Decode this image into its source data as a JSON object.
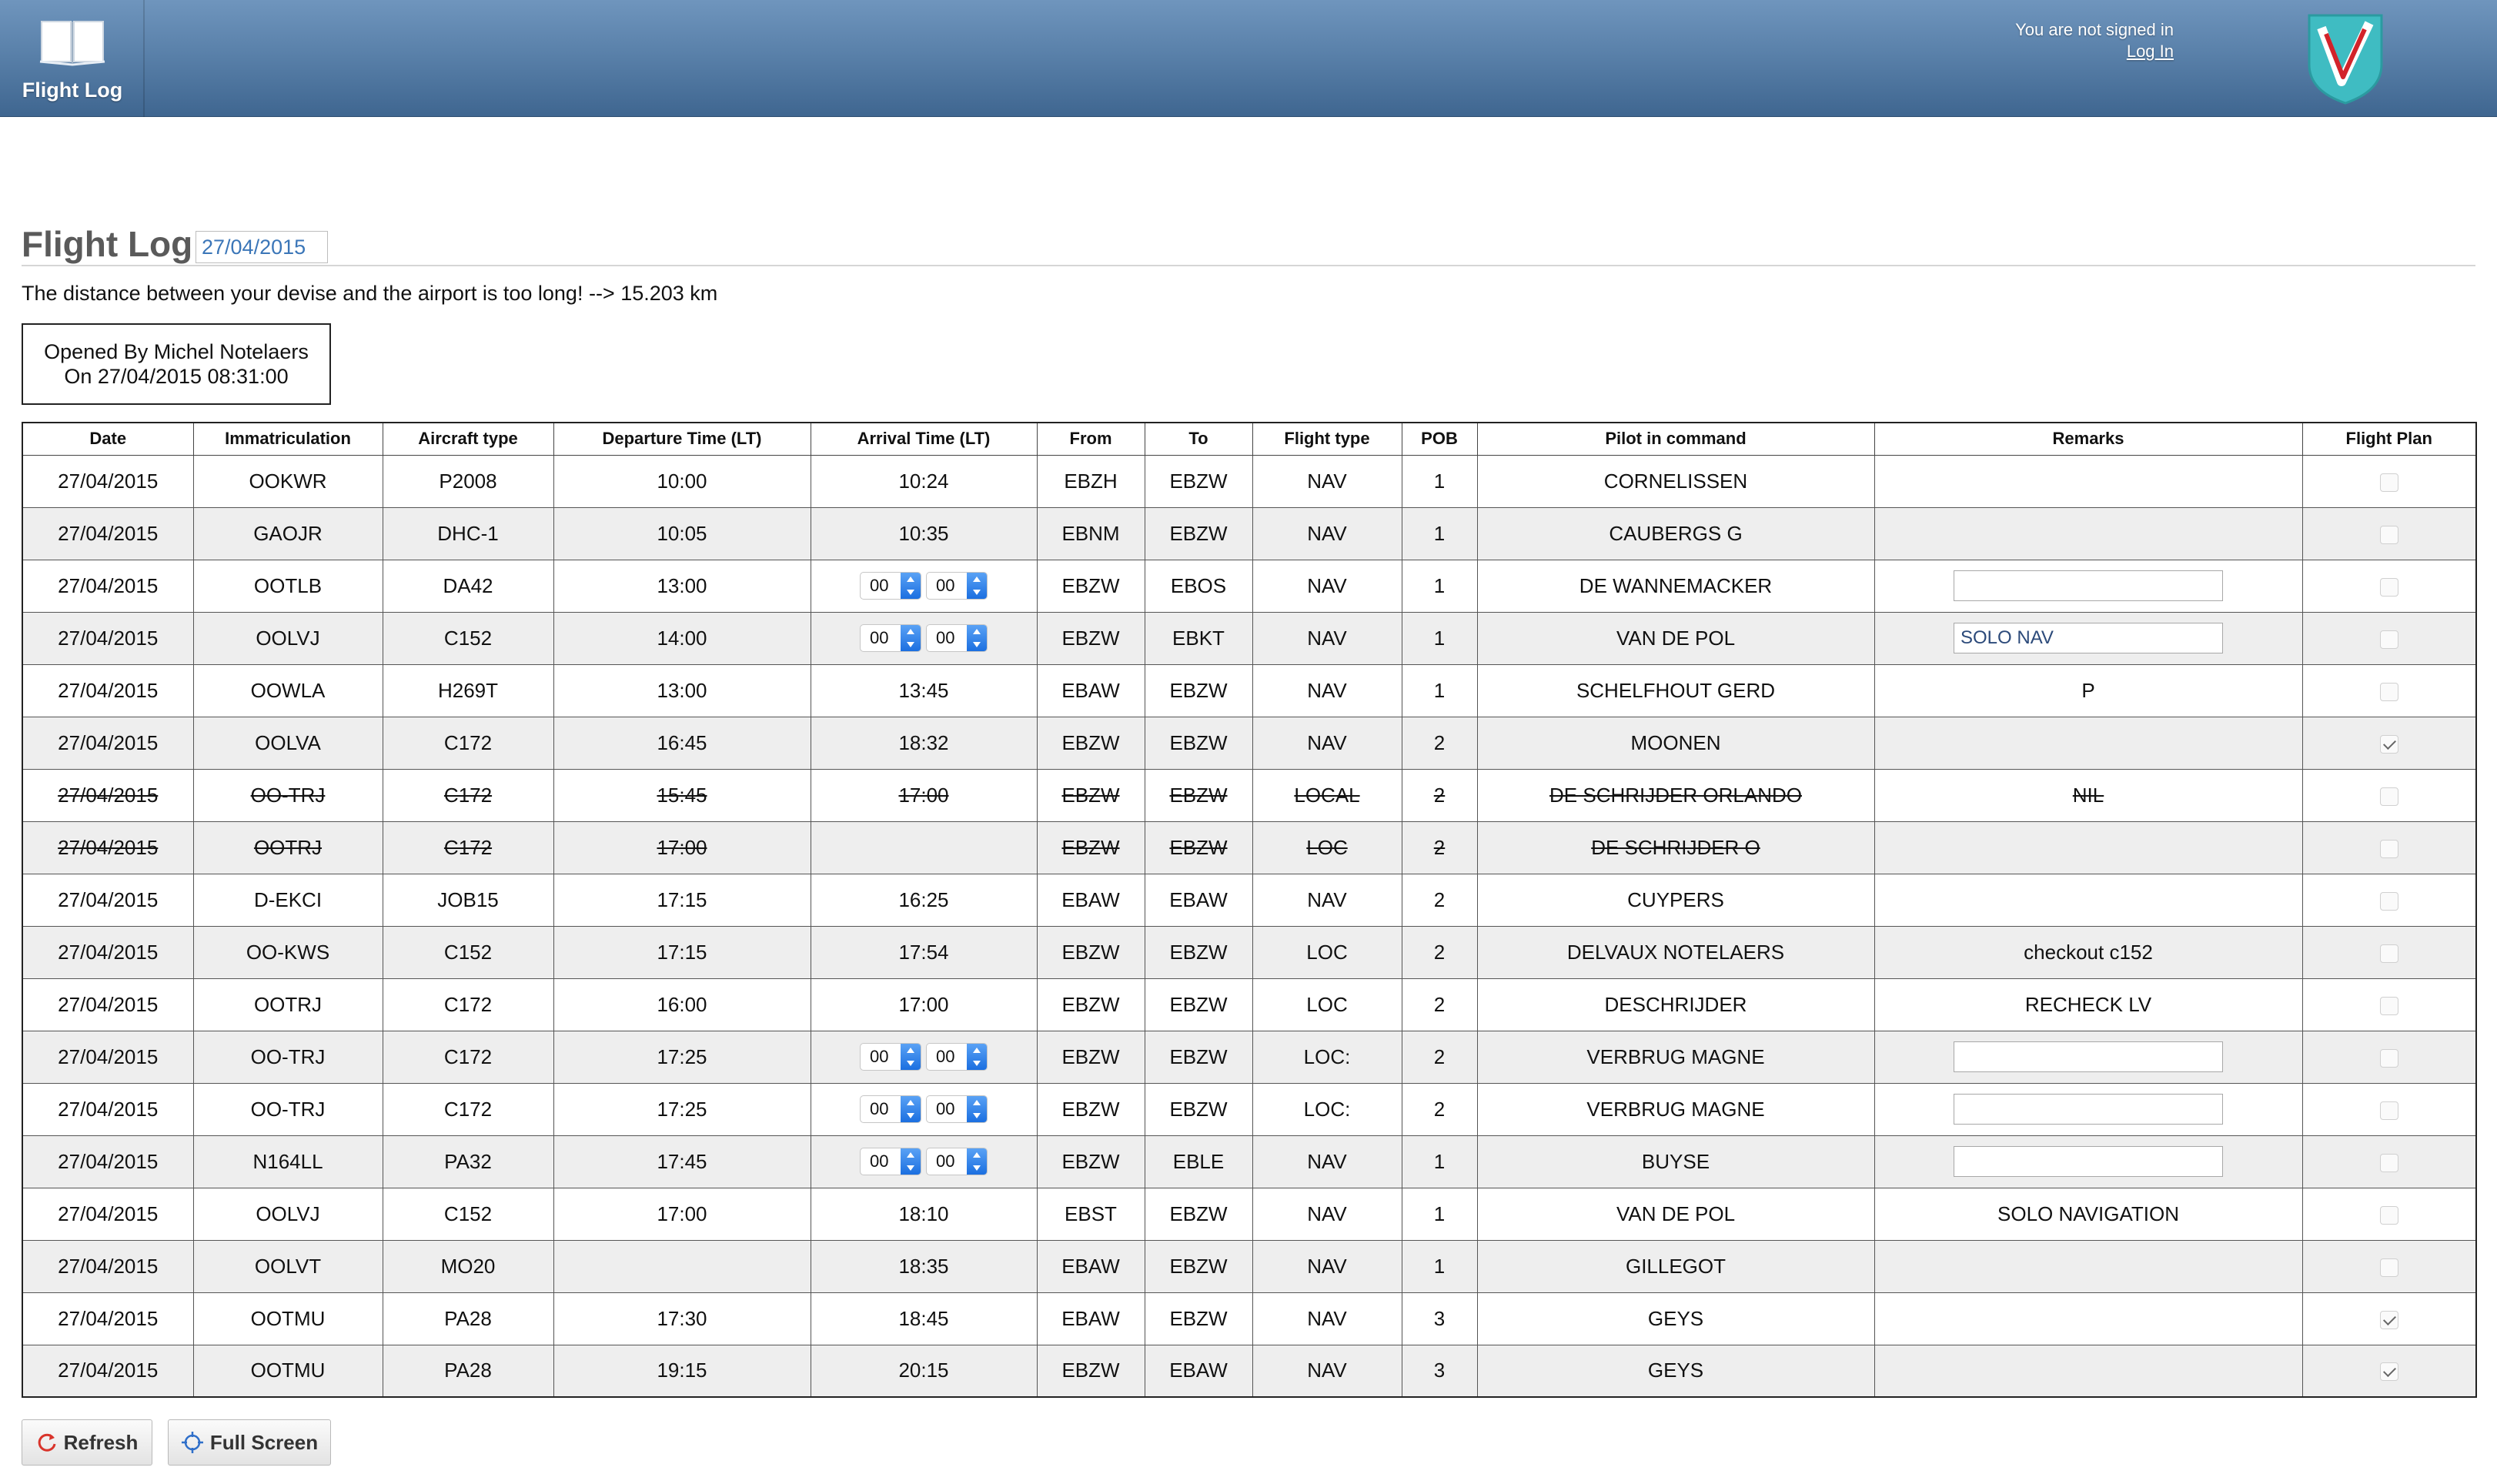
{
  "header": {
    "app_title": "Flight Log",
    "signin_status": "You are not signed in",
    "login_link": "Log In"
  },
  "page": {
    "title": "Flight Log",
    "date_value": "27/04/2015",
    "distance_message": "The distance between your devise and the airport is too long! --> 15.203 km",
    "opened_by": "Opened By Michel Notelaers",
    "opened_on": "On 27/04/2015 08:31:00"
  },
  "table": {
    "headers": [
      "Date",
      "Immatriculation",
      "Aircraft type",
      "Departure Time (LT)",
      "Arrival Time (LT)",
      "From",
      "To",
      "Flight type",
      "POB",
      "Pilot in command",
      "Remarks",
      "Flight Plan"
    ],
    "rows": [
      {
        "date": "27/04/2015",
        "immat": "OOKWR",
        "type": "P2008",
        "dep": "10:00",
        "arr": "10:24",
        "arr_editable": false,
        "from": "EBZH",
        "to": "EBZW",
        "flight_type": "NAV",
        "pob": "1",
        "pic": "CORNELISSEN",
        "remarks": "",
        "remarks_editable": false,
        "flight_plan": false,
        "cancelled": false
      },
      {
        "date": "27/04/2015",
        "immat": "GAOJR",
        "type": "DHC-1",
        "dep": "10:05",
        "arr": "10:35",
        "arr_editable": false,
        "from": "EBNM",
        "to": "EBZW",
        "flight_type": "NAV",
        "pob": "1",
        "pic": "CAUBERGS G",
        "remarks": "",
        "remarks_editable": false,
        "flight_plan": false,
        "cancelled": false
      },
      {
        "date": "27/04/2015",
        "immat": "OOTLB",
        "type": "DA42",
        "dep": "13:00",
        "arr": "",
        "arr_editable": true,
        "arr_hh": "00",
        "arr_mm": "00",
        "from": "EBZW",
        "to": "EBOS",
        "flight_type": "NAV",
        "pob": "1",
        "pic": "DE WANNEMACKER",
        "remarks": "",
        "remarks_editable": true,
        "flight_plan": false,
        "cancelled": false
      },
      {
        "date": "27/04/2015",
        "immat": "OOLVJ",
        "type": "C152",
        "dep": "14:00",
        "arr": "",
        "arr_editable": true,
        "arr_hh": "00",
        "arr_mm": "00",
        "from": "EBZW",
        "to": "EBKT",
        "flight_type": "NAV",
        "pob": "1",
        "pic": "VAN DE POL",
        "remarks": "SOLO NAV",
        "remarks_editable": true,
        "flight_plan": false,
        "cancelled": false
      },
      {
        "date": "27/04/2015",
        "immat": "OOWLA",
        "type": "H269T",
        "dep": "13:00",
        "arr": "13:45",
        "arr_editable": false,
        "from": "EBAW",
        "to": "EBZW",
        "flight_type": "NAV",
        "pob": "1",
        "pic": "SCHELFHOUT GERD",
        "remarks": "P",
        "remarks_editable": false,
        "flight_plan": false,
        "cancelled": false
      },
      {
        "date": "27/04/2015",
        "immat": "OOLVA",
        "type": "C172",
        "dep": "16:45",
        "arr": "18:32",
        "arr_editable": false,
        "from": "EBZW",
        "to": "EBZW",
        "flight_type": "NAV",
        "pob": "2",
        "pic": "MOONEN",
        "remarks": "",
        "remarks_editable": false,
        "flight_plan": true,
        "cancelled": false
      },
      {
        "date": "27/04/2015",
        "immat": "OO-TRJ",
        "type": "C172",
        "dep": "15:45",
        "arr": "17:00",
        "arr_editable": false,
        "from": "EBZW",
        "to": "EBZW",
        "flight_type": "LOCAL",
        "pob": "2",
        "pic": "DE SCHRIJDER ORLANDO",
        "remarks": "NIL",
        "remarks_editable": false,
        "flight_plan": false,
        "cancelled": true
      },
      {
        "date": "27/04/2015",
        "immat": "OOTRJ",
        "type": "C172",
        "dep": "17:00",
        "arr": "",
        "arr_editable": false,
        "from": "EBZW",
        "to": "EBZW",
        "flight_type": "LOC",
        "pob": "2",
        "pic": "DE SCHRIJDER O",
        "remarks": "",
        "remarks_editable": false,
        "flight_plan": false,
        "cancelled": true
      },
      {
        "date": "27/04/2015",
        "immat": "D-EKCI",
        "type": "JOB15",
        "dep": "17:15",
        "arr": "16:25",
        "arr_editable": false,
        "from": "EBAW",
        "to": "EBAW",
        "flight_type": "NAV",
        "pob": "2",
        "pic": "CUYPERS",
        "remarks": "",
        "remarks_editable": false,
        "flight_plan": false,
        "cancelled": false
      },
      {
        "date": "27/04/2015",
        "immat": "OO-KWS",
        "type": "C152",
        "dep": "17:15",
        "arr": "17:54",
        "arr_editable": false,
        "from": "EBZW",
        "to": "EBZW",
        "flight_type": "LOC",
        "pob": "2",
        "pic": "DELVAUX NOTELAERS",
        "remarks": "checkout c152",
        "remarks_editable": false,
        "flight_plan": false,
        "cancelled": false
      },
      {
        "date": "27/04/2015",
        "immat": "OOTRJ",
        "type": "C172",
        "dep": "16:00",
        "arr": "17:00",
        "arr_editable": false,
        "from": "EBZW",
        "to": "EBZW",
        "flight_type": "LOC",
        "pob": "2",
        "pic": "DESCHRIJDER",
        "remarks": "RECHECK LV",
        "remarks_editable": false,
        "flight_plan": false,
        "cancelled": false
      },
      {
        "date": "27/04/2015",
        "immat": "OO-TRJ",
        "type": "C172",
        "dep": "17:25",
        "arr": "",
        "arr_editable": true,
        "arr_hh": "00",
        "arr_mm": "00",
        "from": "EBZW",
        "to": "EBZW",
        "flight_type": "LOC:",
        "pob": "2",
        "pic": "VERBRUG MAGNE",
        "remarks": "",
        "remarks_editable": true,
        "flight_plan": false,
        "cancelled": false
      },
      {
        "date": "27/04/2015",
        "immat": "OO-TRJ",
        "type": "C172",
        "dep": "17:25",
        "arr": "",
        "arr_editable": true,
        "arr_hh": "00",
        "arr_mm": "00",
        "from": "EBZW",
        "to": "EBZW",
        "flight_type": "LOC:",
        "pob": "2",
        "pic": "VERBRUG MAGNE",
        "remarks": "",
        "remarks_editable": true,
        "flight_plan": false,
        "cancelled": false
      },
      {
        "date": "27/04/2015",
        "immat": "N164LL",
        "type": "PA32",
        "dep": "17:45",
        "arr": "",
        "arr_editable": true,
        "arr_hh": "00",
        "arr_mm": "00",
        "from": "EBZW",
        "to": "EBLE",
        "flight_type": "NAV",
        "pob": "1",
        "pic": "BUYSE",
        "remarks": "",
        "remarks_editable": true,
        "flight_plan": false,
        "cancelled": false
      },
      {
        "date": "27/04/2015",
        "immat": "OOLVJ",
        "type": "C152",
        "dep": "17:00",
        "arr": "18:10",
        "arr_editable": false,
        "from": "EBST",
        "to": "EBZW",
        "flight_type": "NAV",
        "pob": "1",
        "pic": "VAN DE POL",
        "remarks": "SOLO NAVIGATION",
        "remarks_editable": false,
        "flight_plan": false,
        "cancelled": false
      },
      {
        "date": "27/04/2015",
        "immat": "OOLVT",
        "type": "MO20",
        "dep": "",
        "arr": "18:35",
        "arr_editable": false,
        "from": "EBAW",
        "to": "EBZW",
        "flight_type": "NAV",
        "pob": "1",
        "pic": "GILLEGOT",
        "remarks": "",
        "remarks_editable": false,
        "flight_plan": false,
        "cancelled": false
      },
      {
        "date": "27/04/2015",
        "immat": "OOTMU",
        "type": "PA28",
        "dep": "17:30",
        "arr": "18:45",
        "arr_editable": false,
        "from": "EBAW",
        "to": "EBZW",
        "flight_type": "NAV",
        "pob": "3",
        "pic": "GEYS",
        "remarks": "",
        "remarks_editable": false,
        "flight_plan": true,
        "cancelled": false
      },
      {
        "date": "27/04/2015",
        "immat": "OOTMU",
        "type": "PA28",
        "dep": "19:15",
        "arr": "20:15",
        "arr_editable": false,
        "from": "EBZW",
        "to": "EBAW",
        "flight_type": "NAV",
        "pob": "3",
        "pic": "GEYS",
        "remarks": "",
        "remarks_editable": false,
        "flight_plan": true,
        "cancelled": false
      }
    ]
  },
  "buttons": {
    "refresh_label": "Refresh",
    "refresh_icon": "refresh-icon",
    "fullscreen_label": "Full Screen",
    "fullscreen_icon": "fullscreen-icon"
  },
  "colors": {
    "header_blue": "#5a81aa",
    "title_gray": "#5a5a5a",
    "date_blue": "#3b76b8",
    "spinner_blue": "#1b6fe0",
    "logo_teal": "#3fbcc2",
    "logo_red": "#d2232a"
  }
}
